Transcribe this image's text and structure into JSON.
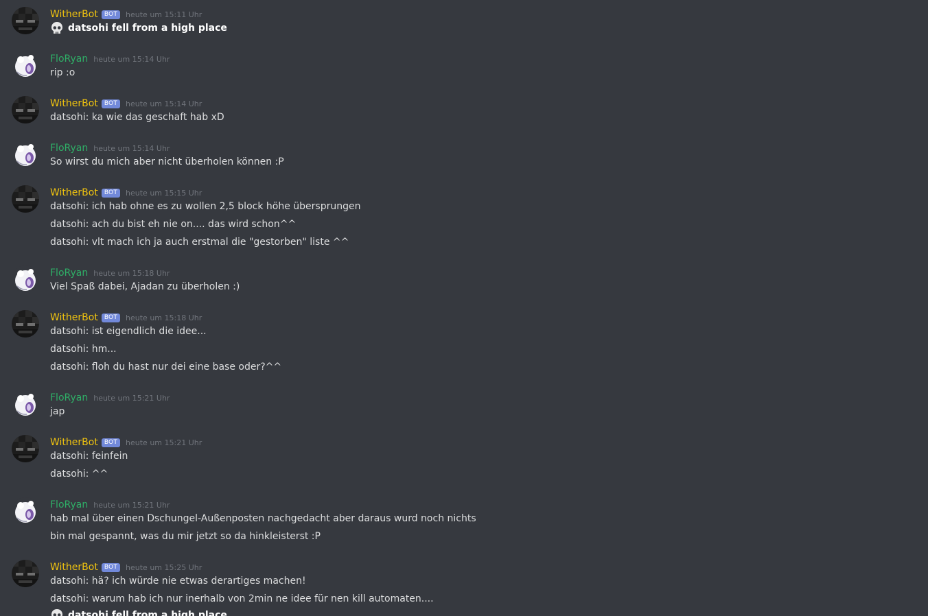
{
  "colors": {
    "background": "#36393f",
    "wither_name": "#f1c40f",
    "flo_name": "#2ecc71",
    "bot_badge": "#7289da",
    "timestamp": "#72767d",
    "text": "#dcddde"
  },
  "badge_label": "BOT",
  "icons": {
    "death": "skull-icon"
  },
  "groups": [
    {
      "author": "WitherBot",
      "timestamp": "heute um 15:11 Uhr",
      "lines": [
        "datsohi fell from a high place"
      ]
    },
    {
      "author": "FloRyan",
      "timestamp": "heute um 15:14 Uhr",
      "lines": [
        "rip :o"
      ]
    },
    {
      "author": "WitherBot",
      "timestamp": "heute um 15:14 Uhr",
      "lines": [
        "datsohi: ka wie das geschaft hab xD"
      ]
    },
    {
      "author": "FloRyan",
      "timestamp": "heute um 15:14 Uhr",
      "lines": [
        "So wirst du mich aber nicht überholen können :P"
      ]
    },
    {
      "author": "WitherBot",
      "timestamp": "heute um 15:15 Uhr",
      "lines": [
        "datsohi: ich hab ohne es zu wollen 2,5 block höhe übersprungen",
        "datsohi: ach du bist eh nie on.... das wird schon^^",
        "datsohi: vlt mach ich ja auch erstmal die \"gestorben\" liste ^^"
      ]
    },
    {
      "author": "FloRyan",
      "timestamp": "heute um 15:18 Uhr",
      "lines": [
        "Viel Spaß dabei, Ajadan zu überholen :)"
      ]
    },
    {
      "author": "WitherBot",
      "timestamp": "heute um 15:18 Uhr",
      "lines": [
        "datsohi: ist eigendlich die idee...",
        "datsohi: hm...",
        "datsohi: floh du hast nur dei eine base oder?^^"
      ]
    },
    {
      "author": "FloRyan",
      "timestamp": "heute um 15:21 Uhr",
      "lines": [
        "jap"
      ]
    },
    {
      "author": "WitherBot",
      "timestamp": "heute um 15:21 Uhr",
      "lines": [
        "datsohi: feinfein",
        "datsohi: ^^"
      ]
    },
    {
      "author": "FloRyan",
      "timestamp": "heute um 15:21 Uhr",
      "lines": [
        "hab mal über einen Dschungel-Außenposten nachgedacht aber daraus wurd noch nichts",
        "bin mal gespannt, was du mir jetzt so da hinkleisterst :P"
      ]
    },
    {
      "author": "WitherBot",
      "timestamp": "heute um 15:25 Uhr",
      "lines": [
        "datsohi: hä? ich würde nie etwas derartiges machen!",
        "datsohi: warum hab ich nur inerhalb von 2min ne idee für nen kill automaten....",
        "datsohi fell from a high place"
      ]
    }
  ]
}
